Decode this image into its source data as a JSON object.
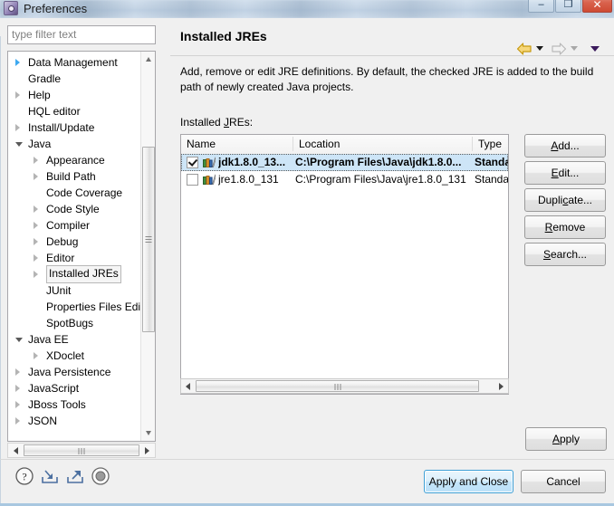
{
  "window": {
    "title": "Preferences",
    "icon": "preferences-icon",
    "controls": {
      "minimize": "–",
      "maximize": "❐",
      "close": "✕"
    }
  },
  "filter": {
    "placeholder": "type filter text",
    "value": ""
  },
  "tree": {
    "items": [
      {
        "label": "Data Management",
        "indent": 0,
        "state": "closed",
        "hot": true,
        "selected": false
      },
      {
        "label": "Gradle",
        "indent": 0,
        "state": "leaf",
        "hot": false,
        "selected": false
      },
      {
        "label": "Help",
        "indent": 0,
        "state": "closed",
        "hot": false,
        "selected": false
      },
      {
        "label": "HQL editor",
        "indent": 0,
        "state": "leaf",
        "hot": false,
        "selected": false
      },
      {
        "label": "Install/Update",
        "indent": 0,
        "state": "closed",
        "hot": false,
        "selected": false
      },
      {
        "label": "Java",
        "indent": 0,
        "state": "open",
        "hot": false,
        "selected": false
      },
      {
        "label": "Appearance",
        "indent": 1,
        "state": "closed",
        "hot": false,
        "selected": false
      },
      {
        "label": "Build Path",
        "indent": 1,
        "state": "closed",
        "hot": false,
        "selected": false
      },
      {
        "label": "Code Coverage",
        "indent": 1,
        "state": "leaf",
        "hot": false,
        "selected": false
      },
      {
        "label": "Code Style",
        "indent": 1,
        "state": "closed",
        "hot": false,
        "selected": false
      },
      {
        "label": "Compiler",
        "indent": 1,
        "state": "closed",
        "hot": false,
        "selected": false
      },
      {
        "label": "Debug",
        "indent": 1,
        "state": "closed",
        "hot": false,
        "selected": false
      },
      {
        "label": "Editor",
        "indent": 1,
        "state": "closed",
        "hot": false,
        "selected": false
      },
      {
        "label": "Installed JREs",
        "indent": 1,
        "state": "closed",
        "hot": false,
        "selected": true
      },
      {
        "label": "JUnit",
        "indent": 1,
        "state": "leaf",
        "hot": false,
        "selected": false
      },
      {
        "label": "Properties Files Editor",
        "indent": 1,
        "state": "leaf",
        "hot": false,
        "selected": false
      },
      {
        "label": "SpotBugs",
        "indent": 1,
        "state": "leaf",
        "hot": false,
        "selected": false
      },
      {
        "label": "Java EE",
        "indent": 0,
        "state": "open",
        "hot": false,
        "selected": false
      },
      {
        "label": "XDoclet",
        "indent": 1,
        "state": "closed",
        "hot": false,
        "selected": false
      },
      {
        "label": "Java Persistence",
        "indent": 0,
        "state": "closed",
        "hot": false,
        "selected": false
      },
      {
        "label": "JavaScript",
        "indent": 0,
        "state": "closed",
        "hot": false,
        "selected": false
      },
      {
        "label": "JBoss Tools",
        "indent": 0,
        "state": "closed",
        "hot": false,
        "selected": false
      },
      {
        "label": "JSON",
        "indent": 0,
        "state": "closed",
        "hot": false,
        "selected": false
      }
    ]
  },
  "page": {
    "title": "Installed JREs",
    "description": "Add, remove or edit JRE definitions. By default, the checked JRE is added to the build path of newly created Java projects.",
    "list_label": "Installed JREs:",
    "nav": {
      "back": "back-arrow",
      "back_color": "#d9a520",
      "forward": "forward-arrow",
      "forward_color": "#b9b9b9",
      "menu": "view-menu"
    }
  },
  "table": {
    "columns": [
      {
        "key": "name",
        "label": "Name"
      },
      {
        "key": "location",
        "label": "Location"
      },
      {
        "key": "type",
        "label": "Type"
      }
    ],
    "rows": [
      {
        "checked": true,
        "selected": true,
        "name": "jdk1.8.0_13...",
        "location": "C:\\Program Files\\Java\\jdk1.8.0...",
        "type": "Standard"
      },
      {
        "checked": false,
        "selected": false,
        "name": "jre1.8.0_131",
        "location": "C:\\Program Files\\Java\\jre1.8.0_131",
        "type": "Standard"
      }
    ]
  },
  "side_buttons": [
    {
      "label": "Add...",
      "mnemonic": "A",
      "name": "add-button"
    },
    {
      "label": "Edit...",
      "mnemonic": "E",
      "name": "edit-button"
    },
    {
      "label": "Duplicate...",
      "mnemonic": "c",
      "name": "duplicate-button"
    },
    {
      "label": "Remove",
      "mnemonic": "R",
      "name": "remove-button"
    },
    {
      "label": "Search...",
      "mnemonic": "S",
      "name": "search-button"
    }
  ],
  "footer": {
    "apply": "Apply",
    "apply_mnemonic": "A",
    "apply_and_close": "Apply and Close",
    "cancel": "Cancel",
    "icons": [
      {
        "name": "help-icon",
        "title": "?"
      },
      {
        "name": "import-icon",
        "title": "Import"
      },
      {
        "name": "export-icon",
        "title": "Export"
      },
      {
        "name": "record-icon",
        "title": "Record"
      }
    ]
  },
  "colors": {
    "selection": "#cde5f7",
    "accent": "#3c9fd6",
    "dialog_bg": "#f0f0f0"
  }
}
